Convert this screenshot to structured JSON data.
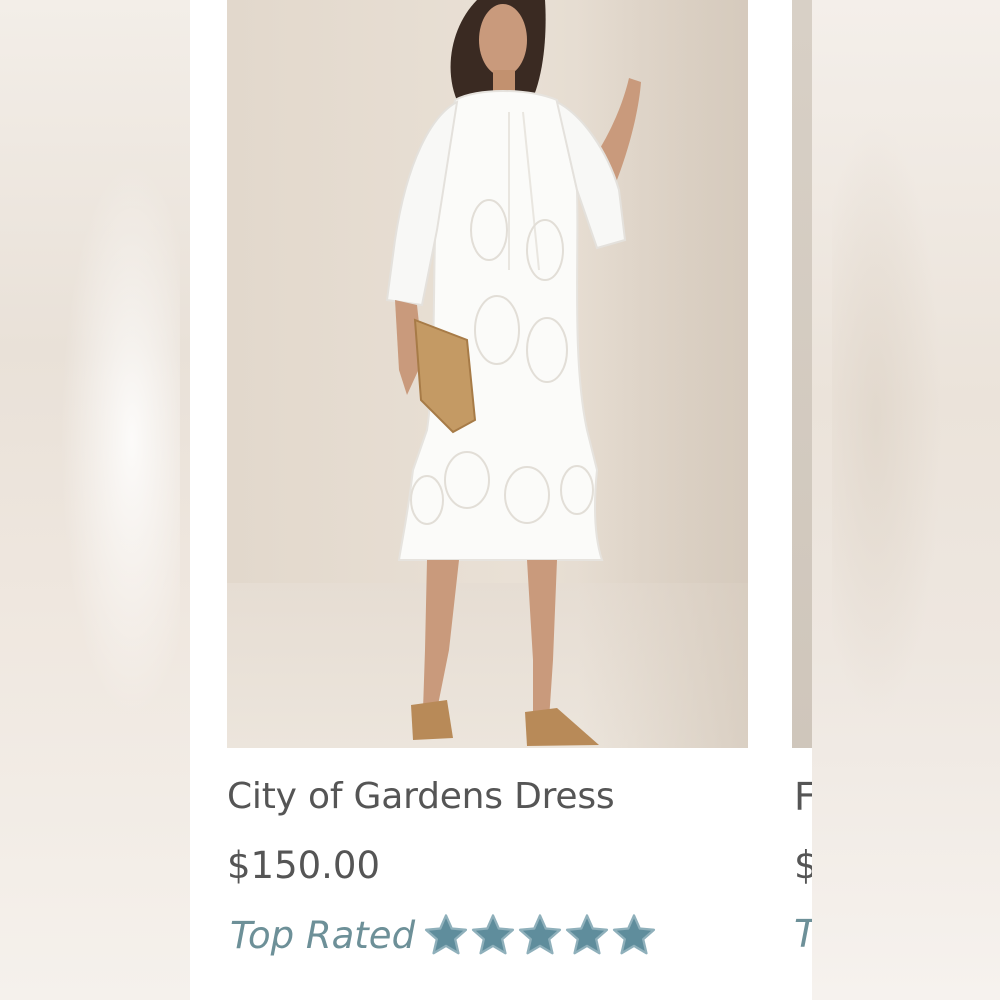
{
  "product": {
    "title": "City of Gardens Dress",
    "price": "$150.00",
    "rating_label": "Top Rated",
    "rating_stars": 5,
    "rating_max": 5,
    "image_alt": "Model wearing white eyelet midi dress holding a woven clutch"
  },
  "next_product": {
    "title_fragment": "F",
    "price_fragment": "$",
    "rating_fragment": "T"
  },
  "colors": {
    "text": "#555555",
    "rating_text": "#6d9098",
    "star_fill": "#5f8d9c",
    "star_stroke": "#8fb0bb",
    "card_background": "#ffffff",
    "image_background": "#e6ddd2"
  },
  "icons": {
    "star": "star-icon"
  }
}
